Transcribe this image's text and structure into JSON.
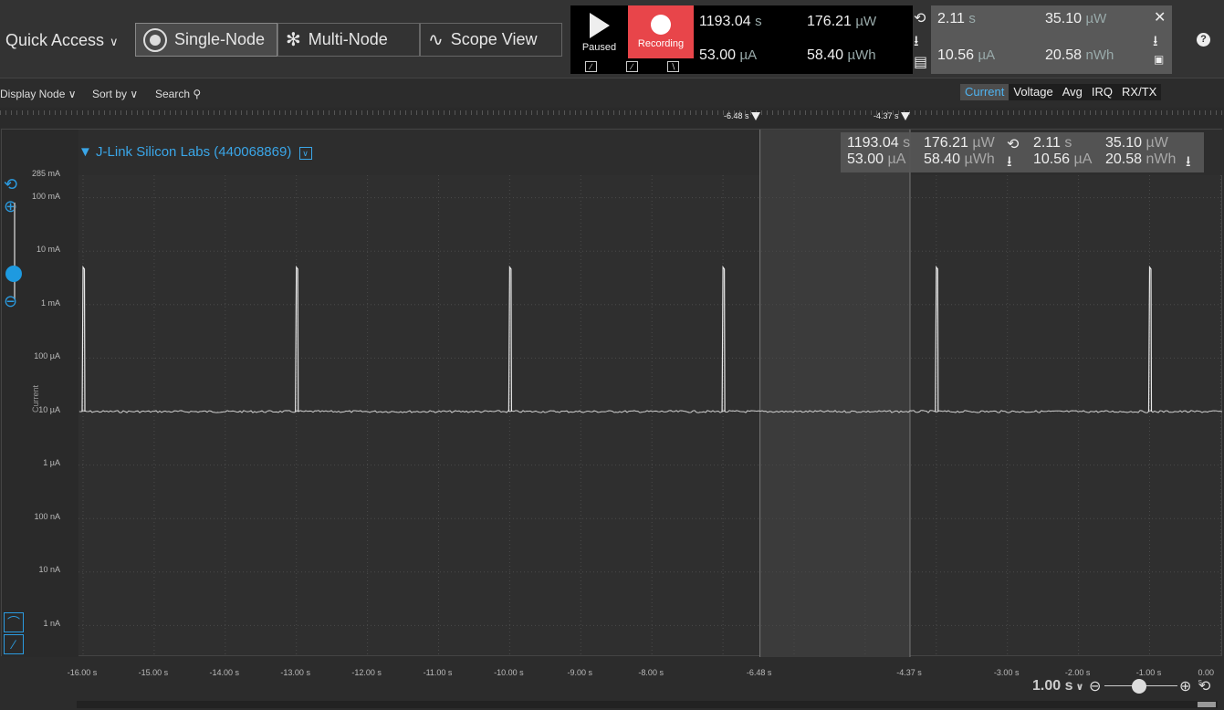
{
  "toolbar": {
    "quick_access": "Quick Access",
    "modes": [
      {
        "label": "Single-Node",
        "active": true
      },
      {
        "label": "Multi-Node",
        "active": false
      },
      {
        "label": "Scope View",
        "active": false
      }
    ],
    "paused_label": "Paused",
    "recording_label": "Recording",
    "stats": {
      "time_value": "1193.04",
      "time_unit": "s",
      "current_value": "53.00",
      "current_unit": "µA",
      "power_value": "176.21",
      "power_unit": "µW",
      "energy_value": "58.40",
      "energy_unit": "µWh",
      "sel_time_value": "2.11",
      "sel_time_unit": "s",
      "sel_current_value": "10.56",
      "sel_current_unit": "µA",
      "sel_power_value": "35.10",
      "sel_power_unit": "µW",
      "sel_energy_value": "20.58",
      "sel_energy_unit": "nWh"
    },
    "help": "?"
  },
  "bar2": {
    "display_node": "Display Node",
    "sort_by": "Sort by",
    "search": "Search",
    "tabs": [
      {
        "label": "Current",
        "active": true
      },
      {
        "label": "Voltage",
        "active": false
      },
      {
        "label": "Avg",
        "active": false
      },
      {
        "label": "IRQ",
        "active": false
      },
      {
        "label": "RX/TX",
        "active": false
      }
    ]
  },
  "markers": {
    "left": "-6.48 s",
    "right": "-4.37 s"
  },
  "plot": {
    "node_title": "J-Link Silicon Labs (440068869)",
    "hdr": {
      "time": "1193.04",
      "time_unit": "s",
      "current": "53.00",
      "current_unit": "µA",
      "power": "176.21",
      "power_unit": "µW",
      "energy": "58.40",
      "energy_unit": "µWh",
      "sel_time": "2.11",
      "sel_time_unit": "s",
      "sel_current": "10.56",
      "sel_current_unit": "µA",
      "sel_power": "35.10",
      "sel_power_unit": "µW",
      "sel_energy": "20.58",
      "sel_energy_unit": "nWh"
    },
    "y_labels": [
      "285 mA",
      "100 mA",
      "10 mA",
      "1 mA",
      "100 µA",
      "10 µA",
      "1 µA",
      "100 nA",
      "10 nA",
      "1 nA"
    ],
    "y_title": "Current"
  },
  "x_labels": [
    "-16.00 s",
    "-15.00 s",
    "-14.00 s",
    "-13.00 s",
    "-12.00 s",
    "-11.00 s",
    "-10.00 s",
    "-9.00 s",
    "-8.00 s",
    "-6.48 s",
    "-4.37 s",
    "-3.00 s",
    "-2.00 s",
    "-1.00 s",
    "0.00 s"
  ],
  "time_scale": "1.00 s",
  "chart_data": {
    "type": "line",
    "title": "",
    "xlabel": "",
    "ylabel": "Current",
    "y_scale": "log",
    "xlim": [
      -16.1,
      0
    ],
    "ylim_labels": [
      "1 nA",
      "285 mA"
    ],
    "baseline_current_uA": 10,
    "spike_times_s": [
      -16.0,
      -13.0,
      -10.0,
      -7.0,
      -4.0,
      -1.0
    ],
    "spike_peak_mA": 5,
    "selection_s": [
      -6.48,
      -4.37
    ]
  }
}
